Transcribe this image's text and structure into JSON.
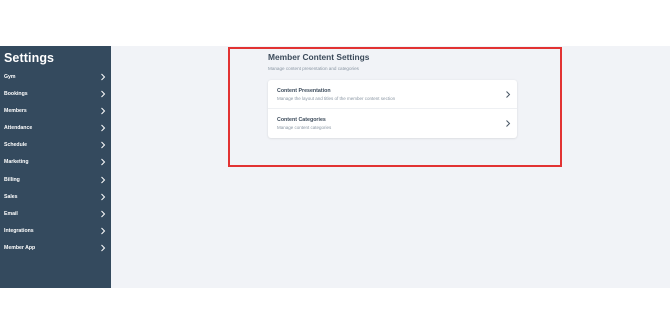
{
  "sidebar": {
    "title": "Settings",
    "items": [
      {
        "label": "Gym"
      },
      {
        "label": "Bookings"
      },
      {
        "label": "Members"
      },
      {
        "label": "Attendance"
      },
      {
        "label": "Schedule"
      },
      {
        "label": "Marketing"
      },
      {
        "label": "Billing"
      },
      {
        "label": "Sales"
      },
      {
        "label": "Email"
      },
      {
        "label": "Integrations"
      },
      {
        "label": "Member App"
      }
    ]
  },
  "main": {
    "title": "Member Content Settings",
    "subtitle": "Manage content presentation and categories",
    "rows": [
      {
        "title": "Content Presentation",
        "description": "Manage the layout and titles of the member content section"
      },
      {
        "title": "Content Categories",
        "description": "Manage content categories"
      }
    ]
  },
  "colors": {
    "sidebar_bg": "#344a5e",
    "main_bg": "#f1f3f7",
    "highlight": "#e23232"
  }
}
